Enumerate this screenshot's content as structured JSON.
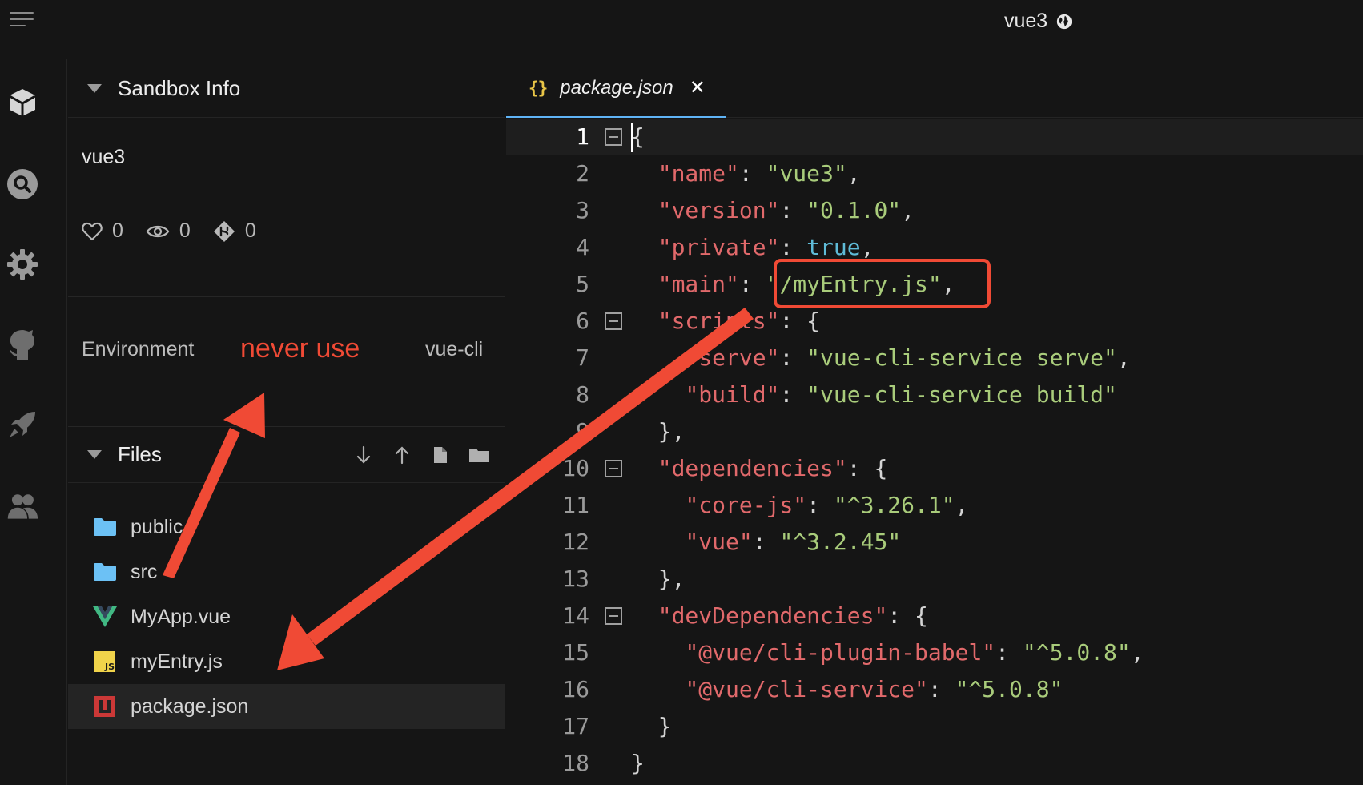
{
  "topbar": {
    "title": "vue3"
  },
  "sidebar": {
    "info_header": "Sandbox Info",
    "sandbox_name": "vue3",
    "stats": {
      "likes": "0",
      "views": "0",
      "forks": "0"
    },
    "environment": {
      "label": "Environment",
      "note": "never use",
      "value": "vue-cli"
    },
    "files_header": "Files",
    "files": [
      {
        "name": "public",
        "icon": "folder-icon"
      },
      {
        "name": "src",
        "icon": "folder-icon"
      },
      {
        "name": "MyApp.vue",
        "icon": "vue-icon"
      },
      {
        "name": "myEntry.js",
        "icon": "js-icon"
      },
      {
        "name": "package.json",
        "icon": "npm-icon",
        "active": true
      }
    ]
  },
  "editor": {
    "tab": {
      "icon": "{}",
      "name": "package.json",
      "close": "✕"
    },
    "lines": [
      {
        "n": "1",
        "fold": true
      },
      {
        "n": "2"
      },
      {
        "n": "3"
      },
      {
        "n": "4"
      },
      {
        "n": "5"
      },
      {
        "n": "6",
        "fold": true
      },
      {
        "n": "7"
      },
      {
        "n": "8"
      },
      {
        "n": "9"
      },
      {
        "n": "10",
        "fold": true
      },
      {
        "n": "11"
      },
      {
        "n": "12"
      },
      {
        "n": "13"
      },
      {
        "n": "14",
        "fold": true
      },
      {
        "n": "15"
      },
      {
        "n": "16"
      },
      {
        "n": "17"
      },
      {
        "n": "18"
      }
    ],
    "code": {
      "l1": "{",
      "l2_key": "\"name\"",
      "l2_val": "\"vue3\"",
      "l3_key": "\"version\"",
      "l3_val": "\"0.1.0\"",
      "l4_key": "\"private\"",
      "l4_val": "true",
      "l5_key": "\"main\"",
      "l5_val": "\"/myEntry.js\"",
      "l6_key": "\"scripts\"",
      "l7_key": "\"serve\"",
      "l7_val": "\"vue-cli-service serve\"",
      "l8_key": "\"build\"",
      "l8_val": "\"vue-cli-service build\"",
      "l9": "},",
      "l10_key": "\"dependencies\"",
      "l11_key": "\"core-js\"",
      "l11_val": "\"^3.26.1\"",
      "l12_key": "\"vue\"",
      "l12_val": "\"^3.2.45\"",
      "l13": "},",
      "l14_key": "\"devDependencies\"",
      "l15_key": "\"@vue/cli-plugin-babel\"",
      "l15_val": "\"^5.0.8\"",
      "l16_key": "\"@vue/cli-service\"",
      "l16_val": "\"^5.0.8\"",
      "l17": "}",
      "l18": "}"
    }
  },
  "colors": {
    "annotation": "#f04a35",
    "key": "#e1696b",
    "string": "#a9cc7b",
    "boolean": "#5fbbd7"
  }
}
